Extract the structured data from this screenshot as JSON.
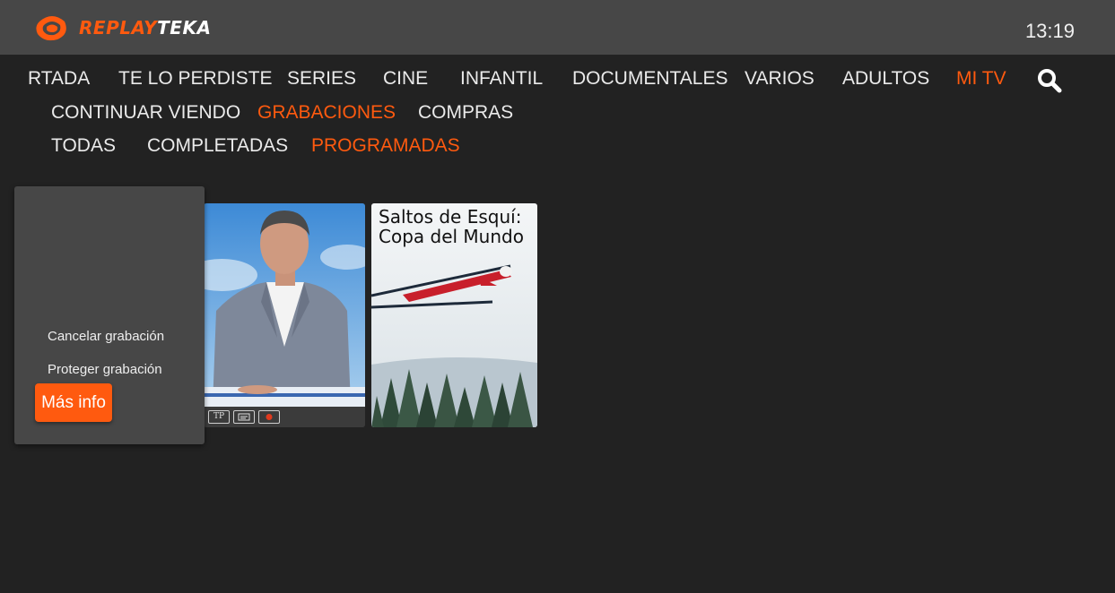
{
  "header": {
    "brand_part1": "REPLAY",
    "brand_part2": "TEKA",
    "clock": "13:19"
  },
  "nav_main": [
    {
      "label": "RTADA",
      "active": false
    },
    {
      "label": "TE LO PERDISTE",
      "active": false
    },
    {
      "label": "SERIES",
      "active": false
    },
    {
      "label": "CINE",
      "active": false
    },
    {
      "label": "INFANTIL",
      "active": false
    },
    {
      "label": "DOCUMENTALES",
      "active": false
    },
    {
      "label": "VARIOS",
      "active": false
    },
    {
      "label": "ADULTOS",
      "active": false
    },
    {
      "label": "MI TV",
      "active": true
    }
  ],
  "nav_sub": [
    {
      "label": "CONTINUAR VIENDO",
      "active": false
    },
    {
      "label": "GRABACIONES",
      "active": true
    },
    {
      "label": "COMPRAS",
      "active": false
    }
  ],
  "nav_filter": [
    {
      "label": "TODAS",
      "active": false
    },
    {
      "label": "COMPLETADAS",
      "active": false
    },
    {
      "label": "PROGRAMADAS",
      "active": true
    }
  ],
  "context_menu": {
    "cancel": "Cancelar grabación",
    "protect": "Proteger grabación",
    "more_info": "Más info"
  },
  "cards": [
    {
      "badges": [
        "TP",
        "subtitles-icon",
        "channel-logo-icon"
      ]
    },
    {
      "title_line1": "Saltos de Esquí:",
      "title_line2": "Copa del Mundo"
    }
  ],
  "badge_text": "TP",
  "colors": {
    "accent": "#ff5a0f",
    "header_bg": "#474747",
    "page_bg": "#222222"
  }
}
